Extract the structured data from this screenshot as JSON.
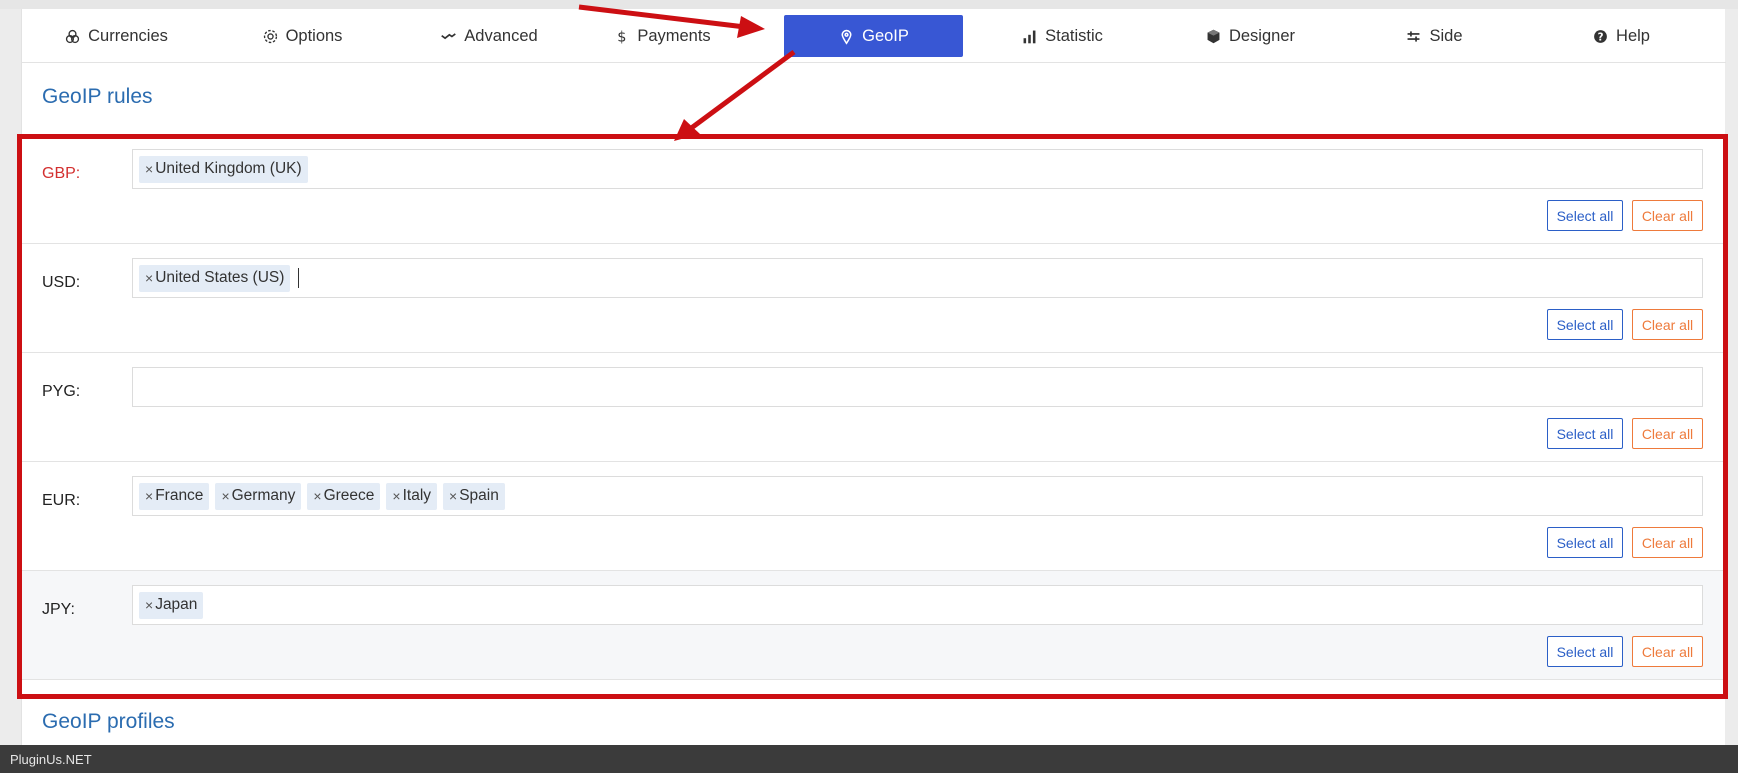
{
  "tabs": [
    {
      "label": "Currencies",
      "icon": "coins-icon"
    },
    {
      "label": "Options",
      "icon": "gear-icon"
    },
    {
      "label": "Advanced",
      "icon": "wave-icon"
    },
    {
      "label": "Payments",
      "icon": "dollar-icon"
    },
    {
      "label": "GeoIP",
      "icon": "map-pin-icon",
      "active": true
    },
    {
      "label": "Statistic",
      "icon": "bar-chart-icon"
    },
    {
      "label": "Designer",
      "icon": "cube-icon"
    },
    {
      "label": "Side",
      "icon": "sliders-icon"
    },
    {
      "label": "Help",
      "icon": "question-circle-icon"
    }
  ],
  "geoip_rules_title": "GeoIP rules",
  "geoip_profiles_title": "GeoIP profiles",
  "buttons": {
    "select_all": "Select all",
    "clear_all": "Clear all"
  },
  "rules": [
    {
      "label": "GBP:",
      "tags": [
        "United Kingdom (UK)"
      ],
      "label_alert": true
    },
    {
      "label": "USD:",
      "tags": [
        "United States (US)"
      ],
      "caret": true
    },
    {
      "label": "PYG:",
      "tags": []
    },
    {
      "label": "EUR:",
      "tags": [
        "France",
        "Germany",
        "Greece",
        "Italy",
        "Spain"
      ]
    },
    {
      "label": "JPY:",
      "tags": [
        "Japan"
      ],
      "shaded": true
    }
  ],
  "tag_remove_glyph": "×",
  "footer": {
    "text": "PluginUs.NET"
  },
  "colors": {
    "accent": "#3857d4",
    "title": "#2b6cb0",
    "highlight": "#cc0f13",
    "select_btn": "#2b5fc7",
    "clear_btn": "#ee7a3b"
  }
}
